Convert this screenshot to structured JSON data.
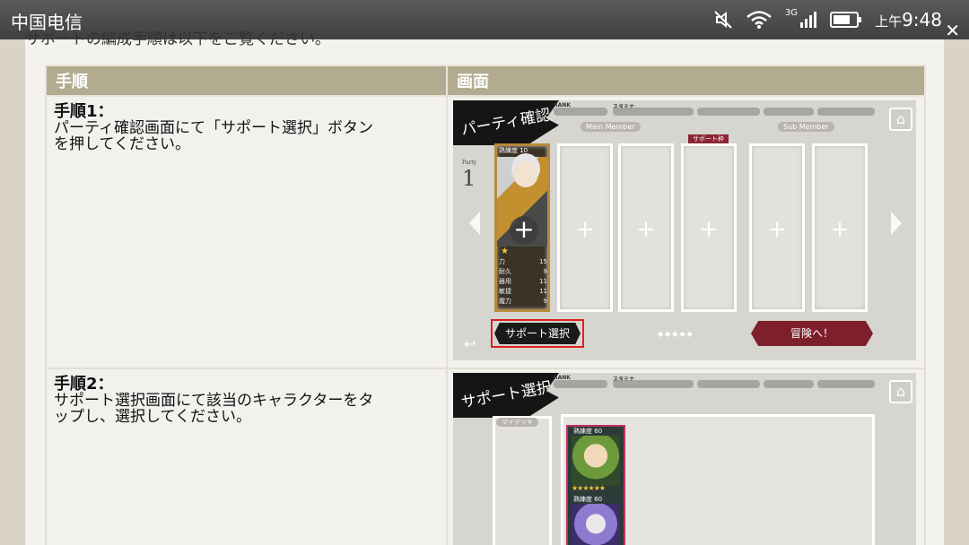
{
  "status_bar": {
    "carrier": "中国电信",
    "network": "3G",
    "ampm": "上午",
    "time": "9:48"
  },
  "page": {
    "intro": "サポートの編成手順は以下をご覧ください。",
    "table_headers": [
      "手順",
      "画面"
    ],
    "steps": [
      {
        "title": "手順1：",
        "desc_line1": "パーティ確認画面にて「サポート選択」ボタン",
        "desc_line2": "を押してください。"
      },
      {
        "title": "手順2：",
        "desc_line1": "サポート選択画面にて該当のキャラクターをタ",
        "desc_line2": "ップし、選択してください。"
      }
    ]
  },
  "screen1": {
    "badge": "パーティ確認",
    "rank_label": "RANK",
    "stamina_label": "スタミナ",
    "main_member": "Main Member",
    "sub_member": "Sub Member",
    "support_tag": "サポート枠",
    "party_label": "Party",
    "party_number": "1",
    "char_level": "熟練度 10",
    "stats": [
      {
        "name": "力",
        "value": "15"
      },
      {
        "name": "耐久",
        "value": "9"
      },
      {
        "name": "器用",
        "value": "11"
      },
      {
        "name": "敏捷",
        "value": "11"
      },
      {
        "name": "魔力",
        "value": "9"
      }
    ],
    "support_button": "サポート選択",
    "adventure_button": "冒険へ！",
    "plus": "+"
  },
  "screen2": {
    "badge": "サポート選択",
    "rank_label": "RANK",
    "stamina_label": "スタミナ",
    "mydeck_label": "マイデッキ",
    "card_level1": "熟練度 60",
    "card_level2": "熟練度 60",
    "card_stars": "★★★★★★"
  },
  "colors": {
    "header_bg": "#b3ab8f",
    "highlight": "#e02020",
    "adventure": "#7e1f2c"
  }
}
